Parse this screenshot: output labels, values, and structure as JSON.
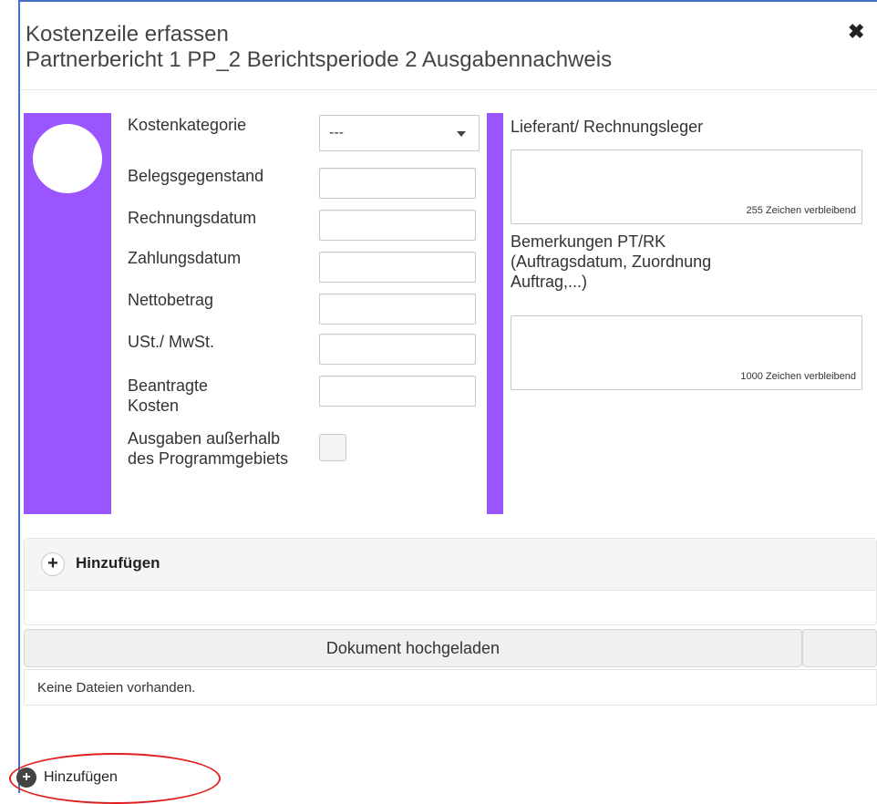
{
  "dialog": {
    "title_line1": "Kostenzeile erfassen",
    "title_line2": "Partnerbericht 1 PP_2 Berichtsperiode 2 Ausgabennachweis",
    "close_icon": "close-icon"
  },
  "form": {
    "labels": {
      "kostenkategorie": "Kostenkategorie",
      "belegsgegenstand": "Belegsgegenstand",
      "rechnungsdatum": "Rechnungsdatum",
      "zahlungsdatum": "Zahlungsdatum",
      "nettobetrag": "Nettobetrag",
      "ust": "USt./ MwSt.",
      "beantragte_kosten": "Beantragte Kosten",
      "ausgaben_ausserhalb": "Ausgaben außerhalb des Programmgebiets"
    },
    "kostenkategorie_value": "---",
    "values": {
      "belegsgegenstand": "",
      "rechnungsdatum": "",
      "zahlungsdatum": "",
      "nettobetrag": "",
      "ust": "",
      "beantragte_kosten": ""
    },
    "ausgaben_ausserhalb_checked": false
  },
  "right": {
    "lieferant_label": "Lieferant/ Rechnungsleger",
    "lieferant_counter": "255 Zeichen verbleibend",
    "bemerkungen_label": "Bemerkungen PT/RK (Auftragsdatum, Zuordnung Auftrag,...)",
    "bemerkungen_counter": "1000 Zeichen verbleibend"
  },
  "attachments": {
    "add_label": "Hinzufügen",
    "table_header": "Dokument hochgeladen",
    "empty_text": "Keine Dateien vorhanden."
  },
  "footer": {
    "add_label": "Hinzufügen"
  },
  "colors": {
    "accent_purple": "#9b55ff",
    "highlight_red": "#e02020",
    "dialog_border": "#4472c4"
  }
}
